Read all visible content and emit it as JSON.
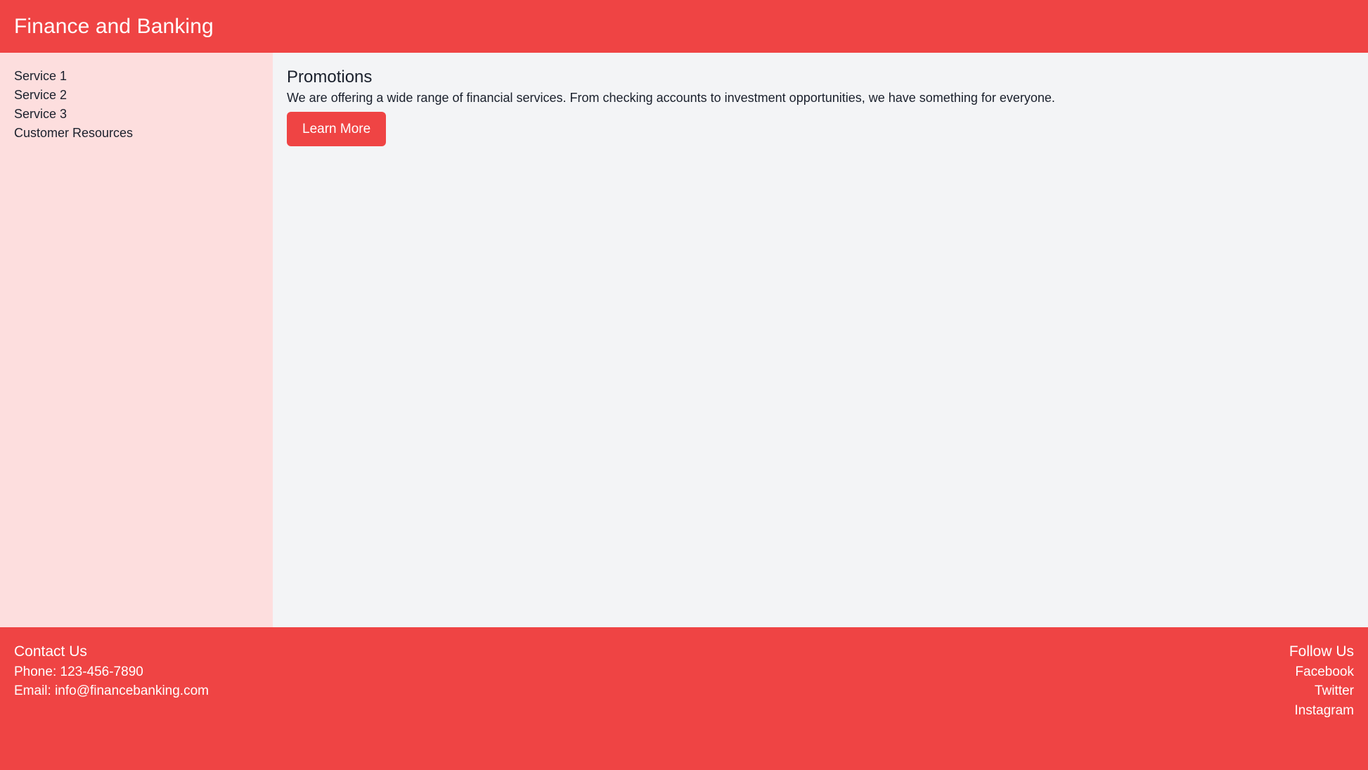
{
  "theme": {
    "accent": "#ef4444",
    "sidebar_bg": "#fddede",
    "main_bg": "#f3f4f6",
    "header_text": "#ffffff",
    "body_text": "#1a202c"
  },
  "header": {
    "title": "Finance and Banking"
  },
  "sidebar": {
    "items": [
      {
        "label": "Service 1"
      },
      {
        "label": "Service 2"
      },
      {
        "label": "Service 3"
      },
      {
        "label": "Customer Resources"
      }
    ]
  },
  "main": {
    "heading": "Promotions",
    "paragraph": "We are offering a wide range of financial services. From checking accounts to investment opportunities, we have something for everyone.",
    "cta_label": "Learn More"
  },
  "footer": {
    "contact": {
      "heading": "Contact Us",
      "phone": "Phone: 123-456-7890",
      "email": "Email: info@financebanking.com"
    },
    "social": {
      "heading": "Follow Us",
      "links": [
        {
          "label": "Facebook"
        },
        {
          "label": "Twitter"
        },
        {
          "label": "Instagram"
        }
      ]
    }
  }
}
